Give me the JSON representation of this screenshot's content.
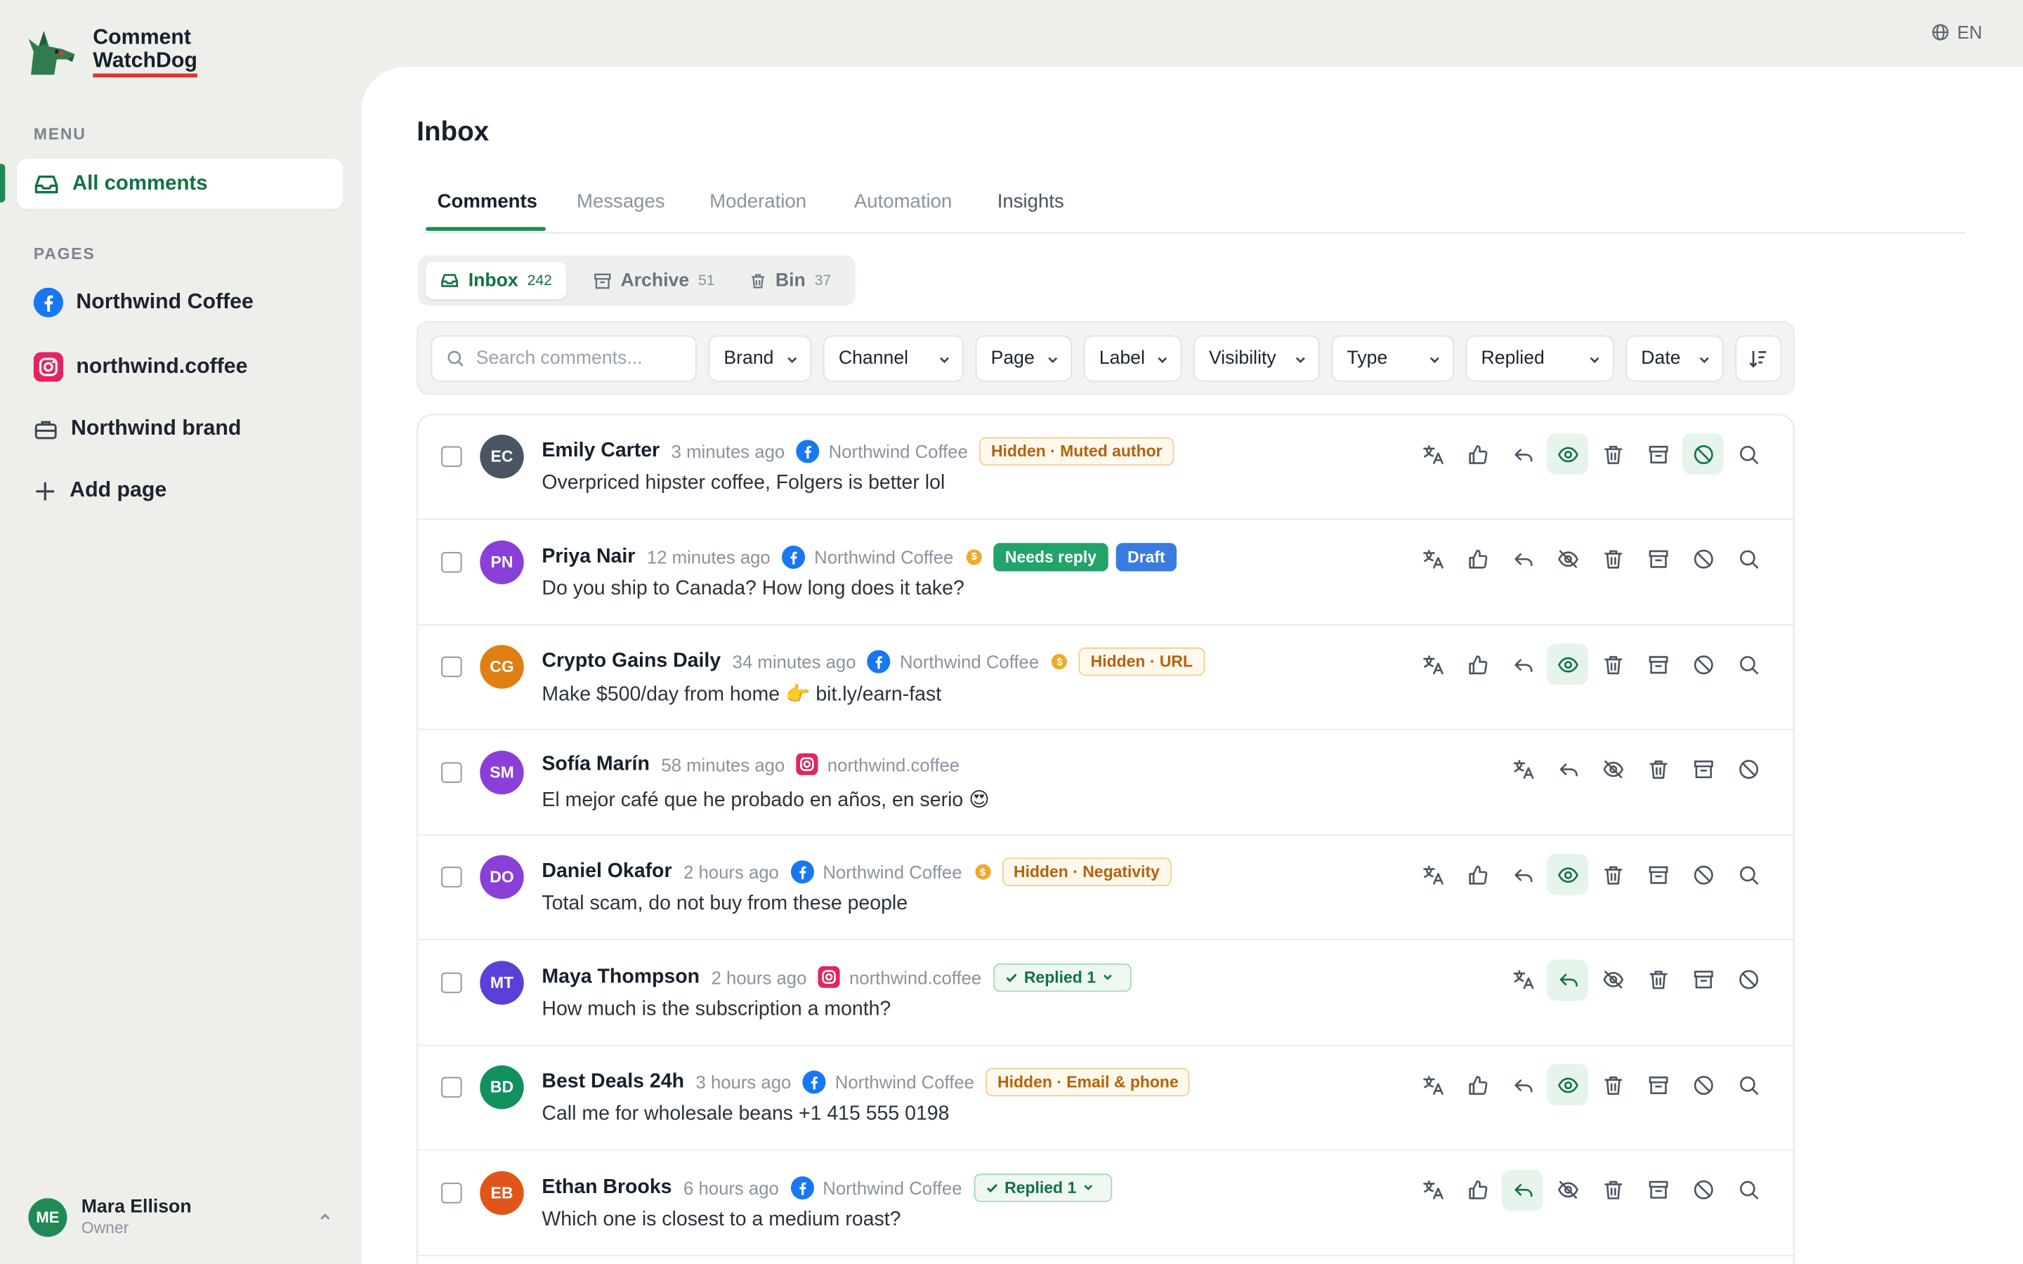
{
  "app": {
    "name_line1": "Comment",
    "name_line2": "WatchDog",
    "language": "EN"
  },
  "sidebar": {
    "menu_label": "MENU",
    "menu_active": "All comments",
    "pages_label": "PAGES",
    "pages": [
      {
        "label": "Northwind Coffee",
        "icon": "facebook-icon"
      },
      {
        "label": "northwind.coffee",
        "icon": "instagram-icon"
      },
      {
        "label": "Northwind brand",
        "icon": "briefcase-icon"
      }
    ],
    "add_page": "Add page",
    "user": {
      "initials": "ME",
      "name": "Mara Ellison",
      "role": "Owner"
    }
  },
  "main": {
    "title": "Inbox",
    "tabs": [
      "Comments",
      "Messages",
      "Moderation",
      "Automation",
      "Insights"
    ],
    "active_tab": "Comments",
    "segments": [
      {
        "label": "Inbox",
        "count": "242"
      },
      {
        "label": "Archive",
        "count": "51"
      },
      {
        "label": "Bin",
        "count": "37"
      }
    ],
    "search_placeholder": "Search comments...",
    "filters": [
      "Brand",
      "Channel",
      "Page",
      "Label",
      "Visibility",
      "Type",
      "Replied",
      "Date"
    ]
  },
  "colors": {
    "accent": "#1f8a56",
    "hidden_badge": "#b5620a",
    "needs_reply": "#22a36a",
    "draft": "#3a7be0"
  },
  "comments": [
    {
      "initials": "EC",
      "avatar_color": "#4a5463",
      "name": "Emily Carter",
      "time": "3 minutes ago",
      "channel": "facebook",
      "page": "Northwind Coffee",
      "coin": false,
      "badges": [
        {
          "type": "hidden",
          "text": "Hidden · Muted author"
        }
      ],
      "text": "Overpriced hipster coffee, Folgers is better lol",
      "actions": [
        "translate",
        "like",
        "reply",
        "show",
        "delete",
        "archive",
        "block",
        "search"
      ],
      "on": [
        "show",
        "block"
      ],
      "show_state": "visible"
    },
    {
      "initials": "PN",
      "avatar_color": "#8a3fd9",
      "name": "Priya Nair",
      "time": "12 minutes ago",
      "channel": "facebook",
      "page": "Northwind Coffee",
      "coin": true,
      "badges": [
        {
          "type": "needs",
          "text": "Needs reply"
        },
        {
          "type": "draft",
          "text": "Draft"
        }
      ],
      "text": "Do you ship to Canada? How long does it take?",
      "actions": [
        "translate",
        "like",
        "reply",
        "hide",
        "delete",
        "archive",
        "block",
        "search"
      ],
      "on": []
    },
    {
      "initials": "CG",
      "avatar_color": "#e07f12",
      "name": "Crypto Gains Daily",
      "time": "34 minutes ago",
      "channel": "facebook",
      "page": "Northwind Coffee",
      "coin": true,
      "badges": [
        {
          "type": "hidden",
          "text": "Hidden · URL"
        }
      ],
      "text": "Make $500/day from home 👉 bit.ly/earn-fast",
      "actions": [
        "translate",
        "like",
        "reply",
        "show",
        "delete",
        "archive",
        "block",
        "search"
      ],
      "on": [
        "show"
      ]
    },
    {
      "initials": "SM",
      "avatar_color": "#8a3fd9",
      "name": "Sofía Marín",
      "time": "58 minutes ago",
      "channel": "instagram",
      "page": "northwind.coffee",
      "coin": false,
      "badges": [],
      "text": "El mejor café que he probado en años, en serio 😍",
      "actions": [
        "translate",
        "reply",
        "hide",
        "delete",
        "archive",
        "block"
      ],
      "on": []
    },
    {
      "initials": "DO",
      "avatar_color": "#8a3fd9",
      "name": "Daniel Okafor",
      "time": "2 hours ago",
      "channel": "facebook",
      "page": "Northwind Coffee",
      "coin": true,
      "badges": [
        {
          "type": "hidden",
          "text": "Hidden · Negativity"
        }
      ],
      "text": "Total scam, do not buy from these people",
      "actions": [
        "translate",
        "like",
        "reply",
        "show",
        "delete",
        "archive",
        "block",
        "search"
      ],
      "on": [
        "show"
      ]
    },
    {
      "initials": "MT",
      "avatar_color": "#5b3fd9",
      "name": "Maya Thompson",
      "time": "2 hours ago",
      "channel": "instagram",
      "page": "northwind.coffee",
      "coin": false,
      "badges": [
        {
          "type": "replied",
          "text": "Replied",
          "count": "1"
        }
      ],
      "text": "How much is the subscription a month?",
      "actions": [
        "translate",
        "reply",
        "hide",
        "delete",
        "archive",
        "block"
      ],
      "on": [
        "reply"
      ]
    },
    {
      "initials": "BD",
      "avatar_color": "#12905e",
      "name": "Best Deals 24h",
      "time": "3 hours ago",
      "channel": "facebook",
      "page": "Northwind Coffee",
      "coin": false,
      "badges": [
        {
          "type": "hidden",
          "text": "Hidden · Email & phone"
        }
      ],
      "text": "Call me for wholesale beans +1 415 555 0198",
      "actions": [
        "translate",
        "like",
        "reply",
        "show",
        "delete",
        "archive",
        "block",
        "search"
      ],
      "on": [
        "show"
      ]
    },
    {
      "initials": "EB",
      "avatar_color": "#e0561a",
      "name": "Ethan Brooks",
      "time": "6 hours ago",
      "channel": "facebook",
      "page": "Northwind Coffee",
      "coin": false,
      "badges": [
        {
          "type": "replied",
          "text": "Replied",
          "count": "1"
        }
      ],
      "text": "Which one is closest to a medium roast?",
      "actions": [
        "translate",
        "like",
        "reply",
        "hide",
        "delete",
        "archive",
        "block",
        "search"
      ],
      "on": [
        "reply"
      ]
    }
  ]
}
